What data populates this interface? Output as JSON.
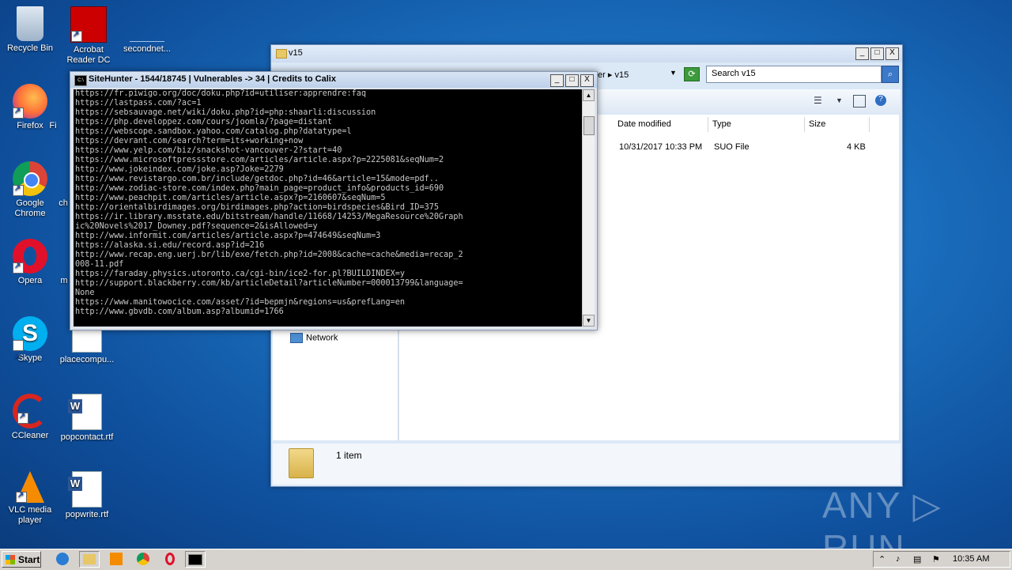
{
  "desktop_icons": [
    {
      "label": "Recycle Bin"
    },
    {
      "label": "Acrobat Reader DC"
    },
    {
      "label": "secondnet..."
    },
    {
      "label": "Firefox"
    },
    {
      "label": "Fi"
    },
    {
      "label": "Google Chrome"
    },
    {
      "label": "ch"
    },
    {
      "label": "Opera"
    },
    {
      "label": "m"
    },
    {
      "label": "Skype"
    },
    {
      "label": "placecompu..."
    },
    {
      "label": "CCleaner"
    },
    {
      "label": "popcontact.rtf"
    },
    {
      "label": "VLC media player"
    },
    {
      "label": "popwrite.rtf"
    }
  ],
  "explorer": {
    "title": "v15",
    "address_tail": "ter  ▸  v15",
    "search_placeholder": "Search v15",
    "columns": [
      "Date modified",
      "Type",
      "Size"
    ],
    "file_row": {
      "date": "10/31/2017 10:33 PM",
      "type": "SUO File",
      "size": "4 KB"
    },
    "nav_network": "Network",
    "status": "1 item",
    "buttons": {
      "min": "_",
      "max": "□",
      "close": "X"
    }
  },
  "console": {
    "title": "SiteHunter - 1544/18745 | Vulnerables -> 34 | Credits to Calix",
    "lines": [
      "https://fr.piwigo.org/doc/doku.php?id=utiliser:apprendre:faq",
      "https://lastpass.com/?ac=1",
      "https://sebsauvage.net/wiki/doku.php?id=php:shaarli:discussion",
      "https://php.developpez.com/cours/joomla/?page=distant",
      "https://webscope.sandbox.yahoo.com/catalog.php?datatype=l",
      "https://devrant.com/search?term=its+working+now",
      "https://www.yelp.com/biz/snackshot-vancouver-2?start=40",
      "https://www.microsoftpressstore.com/articles/article.aspx?p=2225081&seqNum=2",
      "http://www.jokeindex.com/joke.asp?Joke=2279",
      "http://www.revistargo.com.br/include/getdoc.php?id=46&article=15&mode=pdf..",
      "http://www.zodiac-store.com/index.php?main_page=product_info&products_id=690",
      "http://www.peachpit.com/articles/article.aspx?p=2160607&seqNum=5",
      "http://orientalbirdimages.org/birdimages.php?action=birdspecies&Bird_ID=375",
      "https://ir.library.msstate.edu/bitstream/handle/11668/14253/MegaResource%20Graph",
      "ic%20Novels%2017_Downey.pdf?sequence=2&isAllowed=y",
      "http://www.informit.com/articles/article.aspx?p=474649&seqNum=3",
      "https://alaska.si.edu/record.asp?id=216",
      "http://www.recap.eng.uerj.br/lib/exe/fetch.php?id=2008&cache=cache&media=recap_2",
      "008-11.pdf",
      "https://faraday.physics.utoronto.ca/cgi-bin/ice2-for.pl?BUILDINDEX=y",
      "http://support.blackberry.com/kb/articleDetail?articleNumber=000013799&language=",
      "None",
      "https://www.manitowocice.com/asset/?id=bepmjn&regions=us&prefLang=en",
      "http://www.gbvdb.com/album.asp?albumid=1766"
    ]
  },
  "watermark": "ANY ▷ RUN",
  "taskbar": {
    "start_label": "Start",
    "clock": "10:35 AM"
  },
  "colors": {
    "desktop": "#1a6fbe",
    "console_bg": "#000000",
    "console_text": "#c8c8c8"
  }
}
